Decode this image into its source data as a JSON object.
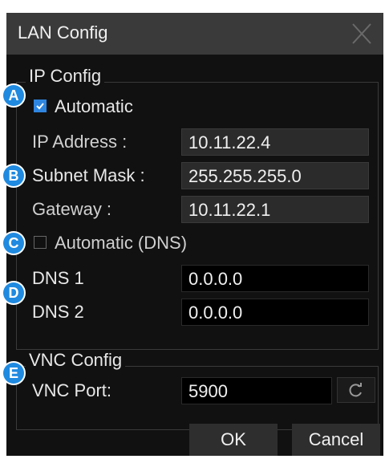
{
  "dialog": {
    "title": "LAN Config"
  },
  "ip_config": {
    "group_label": "IP Config",
    "automatic": {
      "label": "Automatic",
      "checked": true
    },
    "ip_address": {
      "label": "IP Address :",
      "value": "10.11.22.4"
    },
    "subnet_mask": {
      "label": "Subnet Mask :",
      "value": "255.255.255.0"
    },
    "gateway": {
      "label": "Gateway :",
      "value": "10.11.22.1"
    },
    "automatic_dns": {
      "label": "Automatic (DNS)",
      "checked": false
    },
    "dns1": {
      "label": "DNS 1",
      "value": "0.0.0.0"
    },
    "dns2": {
      "label": "DNS 2",
      "value": "0.0.0.0"
    }
  },
  "vnc_config": {
    "group_label": "VNC Config",
    "port": {
      "label": "VNC Port:",
      "value": "5900"
    }
  },
  "buttons": {
    "ok": "OK",
    "cancel": "Cancel"
  },
  "badges": {
    "a": "A",
    "b": "B",
    "c": "C",
    "d": "D",
    "e": "E"
  },
  "colors": {
    "badge": "#1f8ae0",
    "checkbox_checked": "#2f86e0",
    "dialog_bg": "#111111"
  }
}
